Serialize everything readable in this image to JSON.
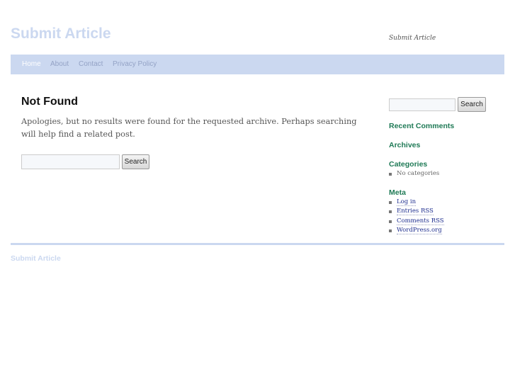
{
  "header": {
    "site_title": "Submit Article",
    "site_description": "Submit Article"
  },
  "nav": {
    "items": [
      {
        "label": "Home",
        "current": true
      },
      {
        "label": "About"
      },
      {
        "label": "Contact"
      },
      {
        "label": "Privacy Policy"
      }
    ]
  },
  "main": {
    "title": "Not Found",
    "message": "Apologies, but no results were found for the requested archive. Perhaps searching will help find a related post.",
    "search": {
      "value": "",
      "button_label": "Search"
    }
  },
  "sidebar": {
    "search": {
      "value": "",
      "button_label": "Search"
    },
    "recent_comments_title": "Recent Comments",
    "archives_title": "Archives",
    "categories_title": "Categories",
    "categories_empty": "No categories",
    "meta_title": "Meta",
    "meta_links": [
      "Log in",
      "Entries RSS",
      "Comments RSS",
      "WordPress.org"
    ]
  },
  "footer": {
    "site_title": "Submit Article"
  },
  "colors": {
    "accent_light_blue": "#cbd8f0",
    "widget_title_green": "#1f7a56",
    "link_blue": "#1f2f8f"
  }
}
